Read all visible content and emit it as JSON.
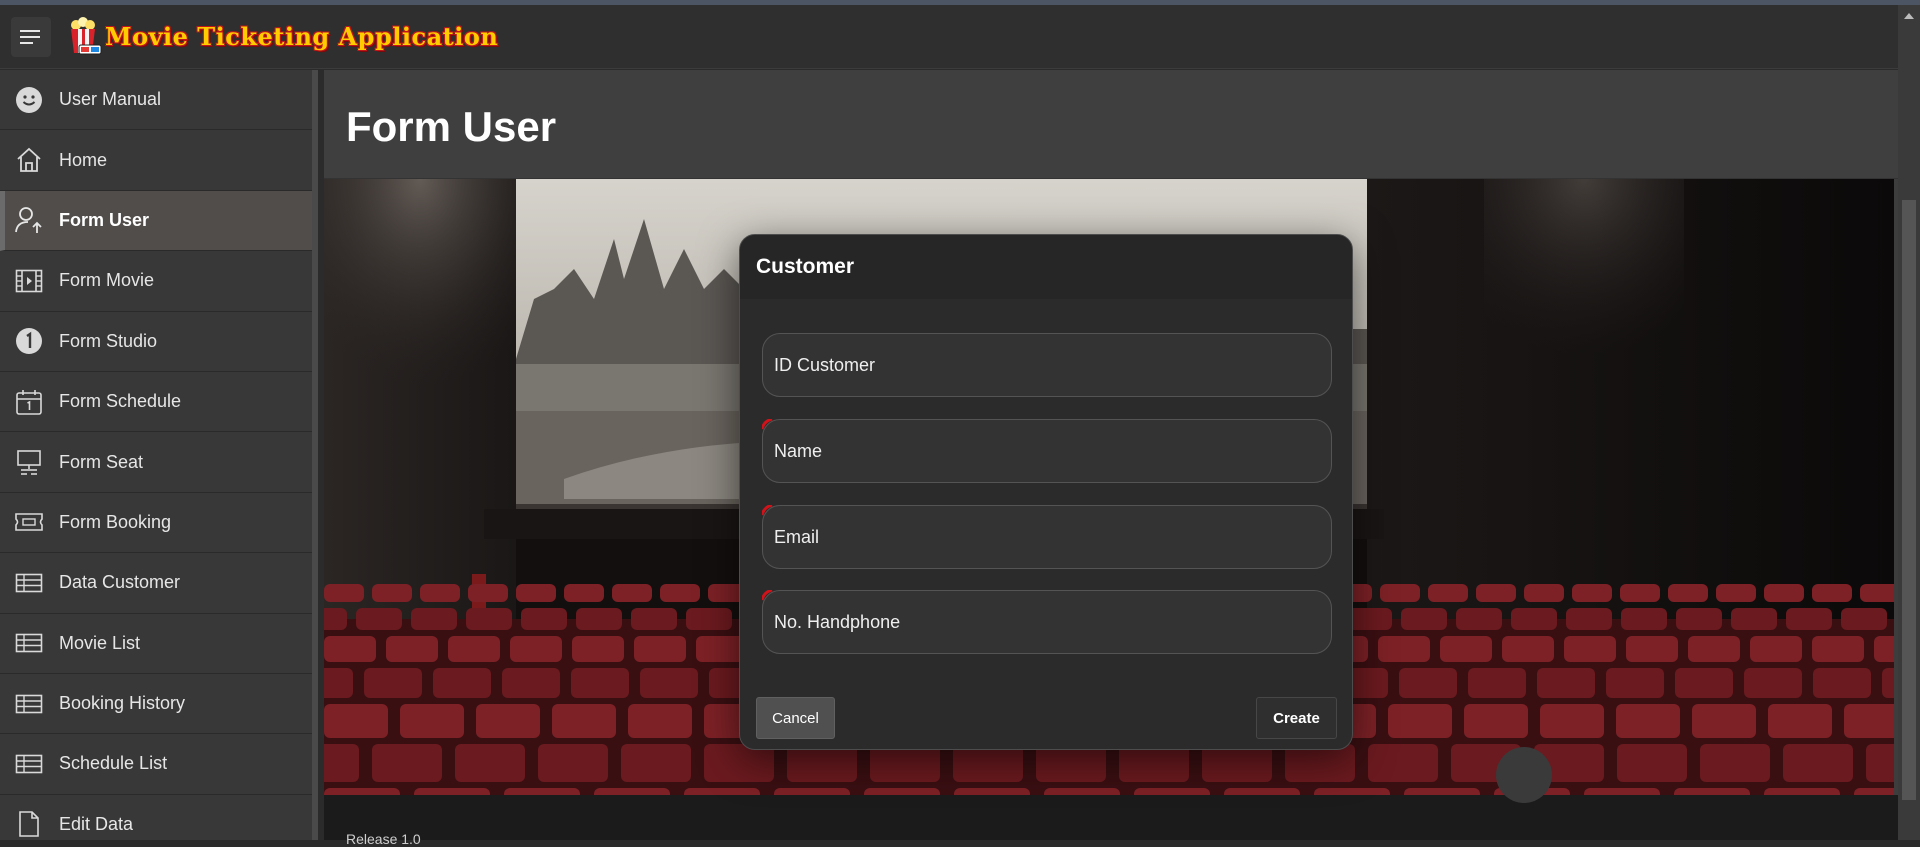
{
  "app": {
    "title": "Movie Ticketing Application",
    "accent_color": "#ffcc00",
    "accent_outline_color": "#c0161a"
  },
  "header": {
    "menu_icon": "hamburger-menu-icon",
    "logo_icon": "popcorn-3d-glasses-icon"
  },
  "sidebar": {
    "items": [
      {
        "label": "User Manual",
        "icon": "smiley-icon",
        "active": false
      },
      {
        "label": "Home",
        "icon": "home-icon",
        "active": false
      },
      {
        "label": "Form User",
        "icon": "user-upload-icon",
        "active": true
      },
      {
        "label": "Form Movie",
        "icon": "film-icon",
        "active": false
      },
      {
        "label": "Form Studio",
        "icon": "number-one-circle-icon",
        "active": false
      },
      {
        "label": "Form Schedule",
        "icon": "calendar-icon",
        "active": false
      },
      {
        "label": "Form Seat",
        "icon": "monitor-icon",
        "active": false
      },
      {
        "label": "Form Booking",
        "icon": "ticket-icon",
        "active": false
      },
      {
        "label": "Data Customer",
        "icon": "table-icon",
        "active": false
      },
      {
        "label": "Movie List",
        "icon": "table-icon",
        "active": false
      },
      {
        "label": "Booking History",
        "icon": "table-icon",
        "active": false
      },
      {
        "label": "Schedule List",
        "icon": "table-icon",
        "active": false
      },
      {
        "label": "Edit Data",
        "icon": "file-icon",
        "active": false
      }
    ]
  },
  "main": {
    "page_title": "Form User",
    "hero_icon": "cinema-hall-background-image",
    "footer_text": "Release 1.0"
  },
  "dialog": {
    "title": "Customer",
    "fields": [
      {
        "label": "ID Customer",
        "required": false
      },
      {
        "label": "Name",
        "required": true
      },
      {
        "label": "Email",
        "required": true
      },
      {
        "label": "No. Handphone",
        "required": true
      }
    ],
    "cancel_label": "Cancel",
    "create_label": "Create"
  }
}
